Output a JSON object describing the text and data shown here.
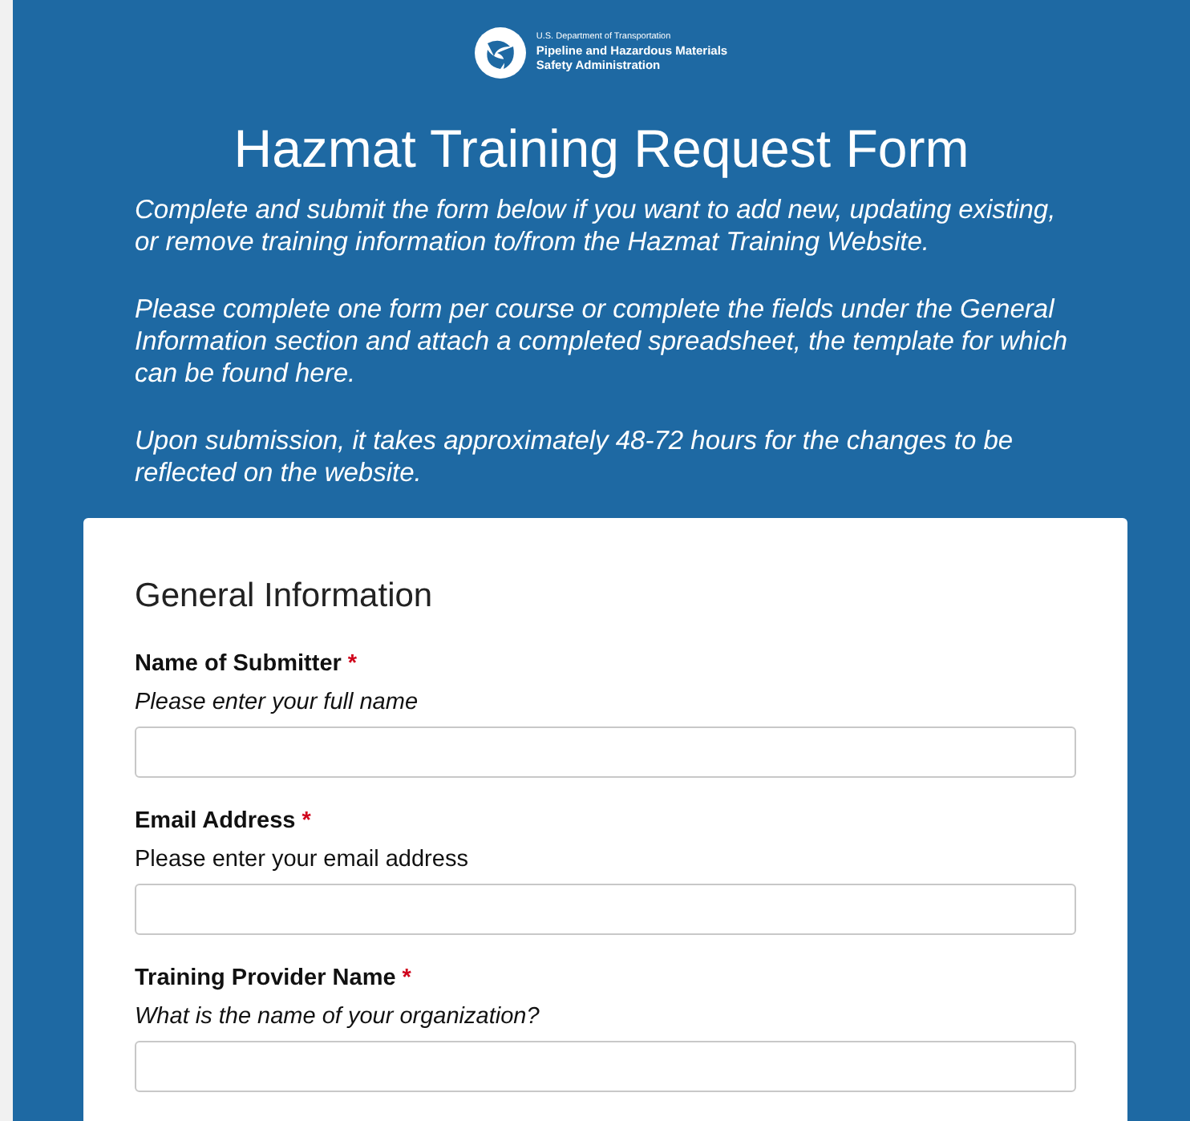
{
  "agency": {
    "department": "U.S. Department of Transportation",
    "name_line_1": "Pipeline and Hazardous Materials",
    "name_line_2": "Safety Administration"
  },
  "title": "Hazmat Training Request Form",
  "intro": [
    "Complete and submit the form below if you want to add new, updating existing, or remove training information to/from the Hazmat Training Website.",
    "Please complete one form per course or complete the fields under the General Information section and attach a completed spreadsheet, the template for which can be found here.",
    "Upon submission, it takes approximately 48-72 hours for the changes to be reflected on the website."
  ],
  "section": {
    "heading": "General Information",
    "fields": [
      {
        "label": "Name of Submitter",
        "required_mark": "*",
        "hint": "Please enter your full name",
        "hint_italic": true
      },
      {
        "label": "Email Address",
        "required_mark": "*",
        "hint": "Please enter your email address",
        "hint_italic": false
      },
      {
        "label": "Training Provider Name",
        "required_mark": "*",
        "hint": "What is the name of your organization?",
        "hint_italic": true
      }
    ]
  }
}
